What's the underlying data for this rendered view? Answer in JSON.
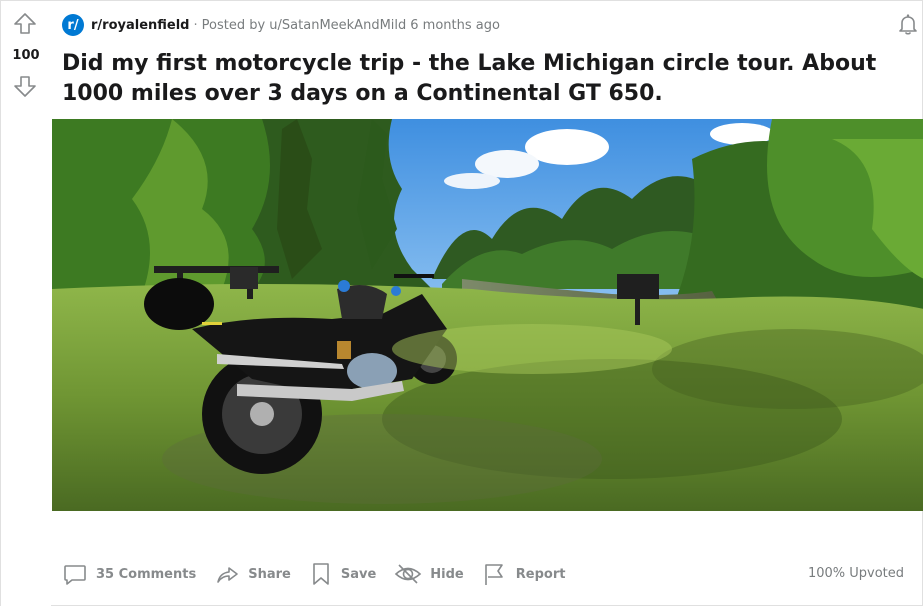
{
  "post": {
    "score": "100",
    "subreddit": "r/royalenfield",
    "subreddit_icon_text": "r/",
    "posted_by": "Posted by u/SatanMeekAndMild",
    "age": "6 months ago",
    "title": "Did my first motorcycle trip - the Lake Michigan circle tour. About 1000 miles over 3 days on a Continental GT 650.",
    "upvote_ratio": "100% Upvoted"
  },
  "actions": {
    "comments": "35 Comments",
    "share": "Share",
    "save": "Save",
    "hide": "Hide",
    "report": "Report"
  },
  "icons": {
    "upvote": "arrow-up-icon",
    "downvote": "arrow-down-icon",
    "notify": "bell-icon",
    "comments": "comment-bubble-icon",
    "share": "share-arrow-icon",
    "save": "bookmark-icon",
    "hide": "eye-slash-icon",
    "report": "flag-icon"
  },
  "colors": {
    "subreddit_icon": "#0079d3",
    "icon_gray": "#878a8c"
  }
}
